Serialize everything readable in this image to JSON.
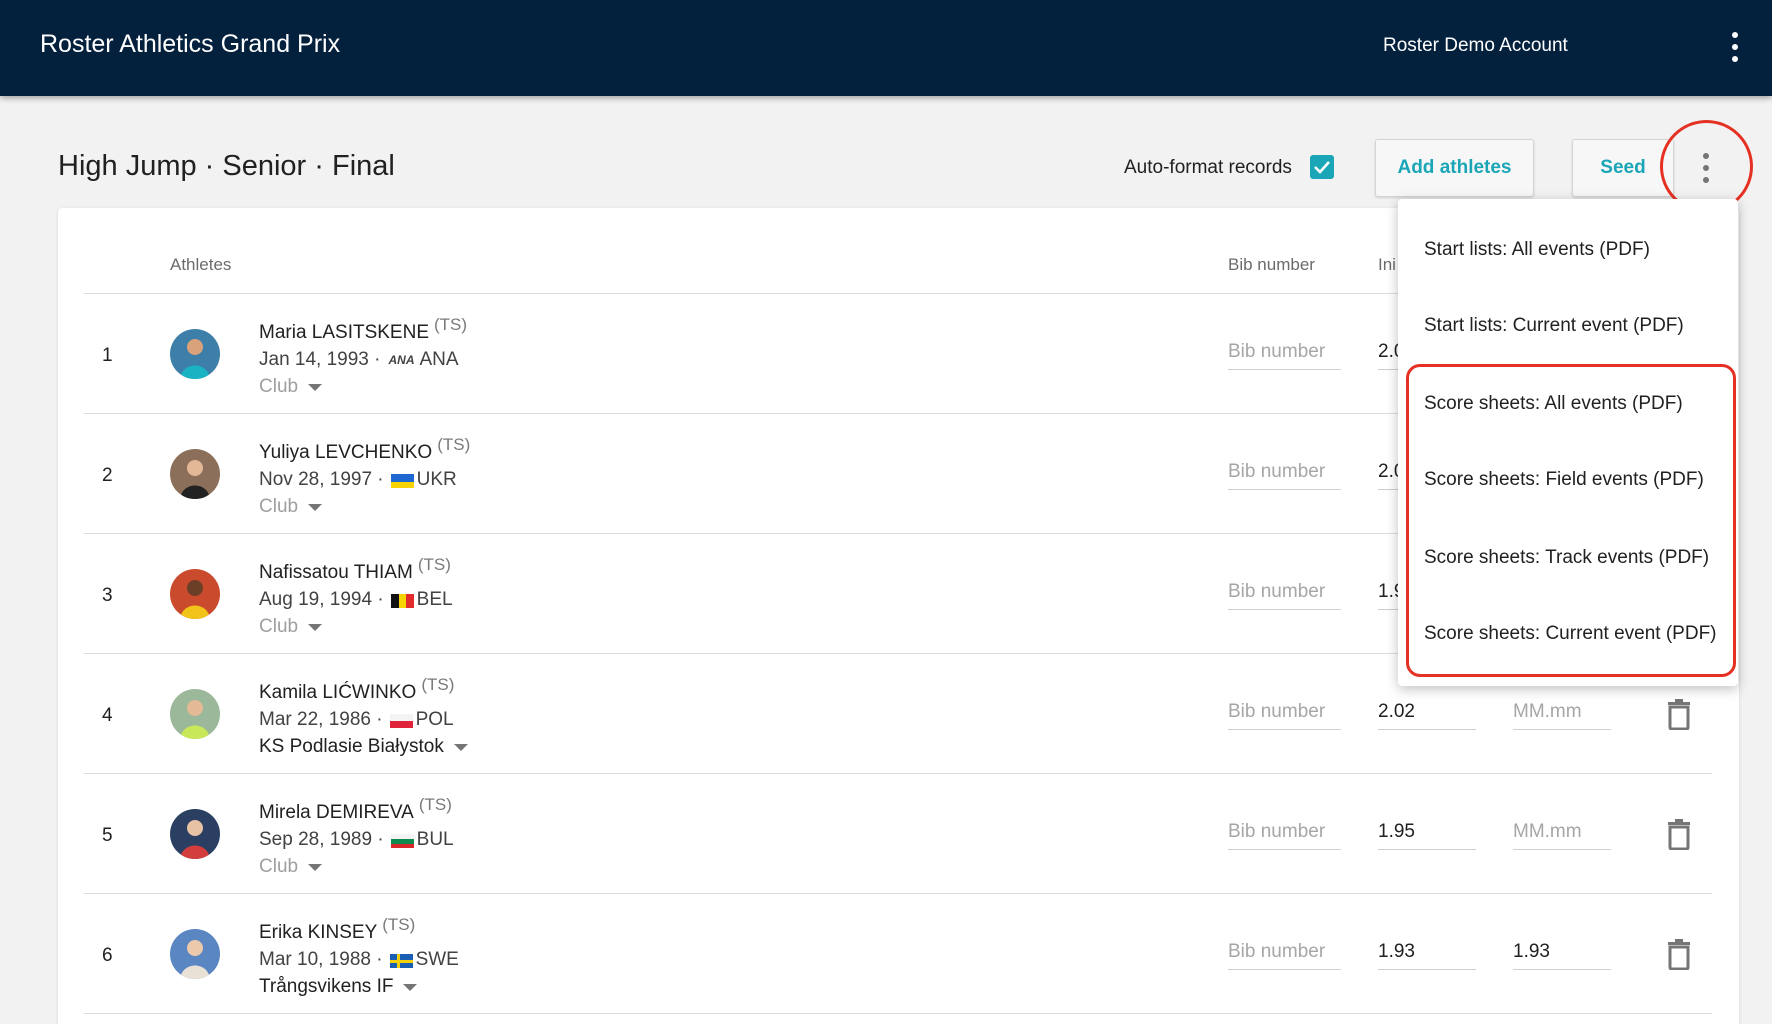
{
  "appbar": {
    "title": "Roster Athletics Grand Prix",
    "account": "Roster Demo Account"
  },
  "event": {
    "title": "High Jump · Senior · Final",
    "auto_format_label": "Auto-format records",
    "auto_format_checked": true
  },
  "buttons": {
    "add_athletes": "Add athletes",
    "seed": "Seed"
  },
  "table": {
    "headers": {
      "athletes": "Athletes",
      "bib": "Bib number",
      "initial": "Ini"
    },
    "rows": [
      {
        "num": "1",
        "name": "Maria LASITSKENE",
        "tag": "(TS)",
        "dob": "Jan 14, 1993 ·",
        "country": "ANA",
        "flag_mark": "ANA",
        "club": "Club",
        "bib": "Bib number",
        "initial": "2.0"
      },
      {
        "num": "2",
        "name": "Yuliya LEVCHENKO",
        "tag": "(TS)",
        "dob": "Nov 28, 1997 ·",
        "country": "UKR",
        "club": "Club",
        "bib": "Bib number",
        "initial": "2.0"
      },
      {
        "num": "3",
        "name": "Nafissatou THIAM",
        "tag": "(TS)",
        "dob": "Aug 19, 1994 ·",
        "country": "BEL",
        "club": "Club",
        "bib": "Bib number",
        "initial": "1.9"
      },
      {
        "num": "4",
        "name": "Kamila LIĆWINKO",
        "tag": "(TS)",
        "dob": "Mar 22, 1986 ·",
        "country": "POL",
        "club": "KS Podlasie Białystok",
        "bib": "Bib number",
        "initial": "2.02",
        "best": "MM.mm"
      },
      {
        "num": "5",
        "name": "Mirela DEMIREVA",
        "tag": "(TS)",
        "dob": "Sep 28, 1989 ·",
        "country": "BUL",
        "club": "Club",
        "bib": "Bib number",
        "initial": "1.95",
        "best": "MM.mm"
      },
      {
        "num": "6",
        "name": "Erika KINSEY",
        "tag": "(TS)",
        "dob": "Mar 10, 1988 ·",
        "country": "SWE",
        "club": "Trångsvikens IF",
        "bib": "Bib number",
        "initial": "1.93",
        "best": "1.93"
      }
    ]
  },
  "menu": {
    "items": [
      "Start lists: All events (PDF)",
      "Start lists: Current event (PDF)",
      "Score sheets: All events (PDF)",
      "Score sheets: Field events (PDF)",
      "Score sheets: Track events (PDF)",
      "Score sheets: Current event (PDF)"
    ]
  },
  "colors": {
    "appbar": "#03203d",
    "accent": "#1aa6b7",
    "annotation": "#e53123"
  },
  "icons": {
    "menu": "more-vertical-icon",
    "check": "check-icon",
    "dropdown": "caret-down-icon",
    "delete": "trash-icon"
  }
}
